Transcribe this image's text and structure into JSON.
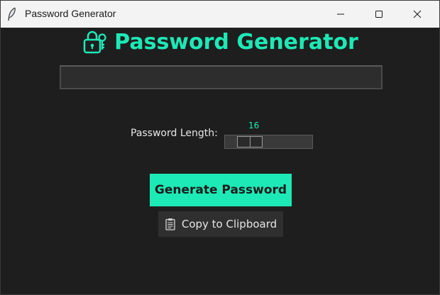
{
  "window": {
    "title": "Password Generator",
    "app_icon": "feather-icon",
    "controls": [
      "minimize-icon",
      "maximize-icon",
      "close-icon"
    ]
  },
  "header": {
    "icon": "lock-icon",
    "title": "Password Generator"
  },
  "password_field": {
    "value": "",
    "placeholder": ""
  },
  "length": {
    "label": "Password Length:",
    "value": "16",
    "slider_fraction": 0.2
  },
  "buttons": {
    "generate_label": "Generate Password",
    "copy_label": "Copy to Clipboard",
    "copy_icon": "clipboard-icon"
  },
  "colors": {
    "accent": "#1de9b6",
    "background": "#1e1e1e",
    "titlebar": "#f3f3f3",
    "field_bg": "#2d2d2d",
    "secondary_button": "#2f2f2f"
  }
}
